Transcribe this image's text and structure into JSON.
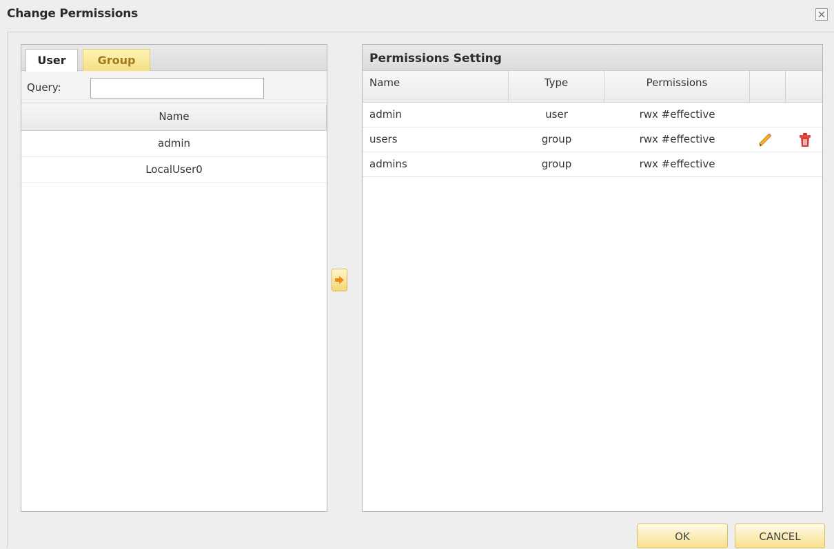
{
  "dialog": {
    "title": "Change Permissions",
    "close_icon": "close-x"
  },
  "left": {
    "tabs": [
      {
        "label": "User",
        "active": true
      },
      {
        "label": "Group",
        "active": false
      }
    ],
    "query_label": "Query:",
    "query_value": "",
    "column": "Name",
    "users": [
      "admin",
      "LocalUser0"
    ]
  },
  "add_button_icon": "arrow-right",
  "right": {
    "title": "Permissions Setting",
    "columns": [
      "Name",
      "Type",
      "Permissions",
      "",
      ""
    ],
    "rows": [
      {
        "name": "admin",
        "type": "user",
        "permissions": "rwx #effective",
        "editable": false
      },
      {
        "name": "users",
        "type": "group",
        "permissions": "rwx #effective",
        "editable": true
      },
      {
        "name": "admins",
        "type": "group",
        "permissions": "rwx #effective",
        "editable": false
      }
    ],
    "row_icons": {
      "edit": "pencil-icon",
      "delete": "trash-icon"
    }
  },
  "buttons": {
    "ok": "OK",
    "cancel": "CANCEL"
  },
  "colors": {
    "accent_button": "#f7e08c",
    "tab_inactive_text": "#a07a1a",
    "delete_red": "#d83a3a"
  }
}
